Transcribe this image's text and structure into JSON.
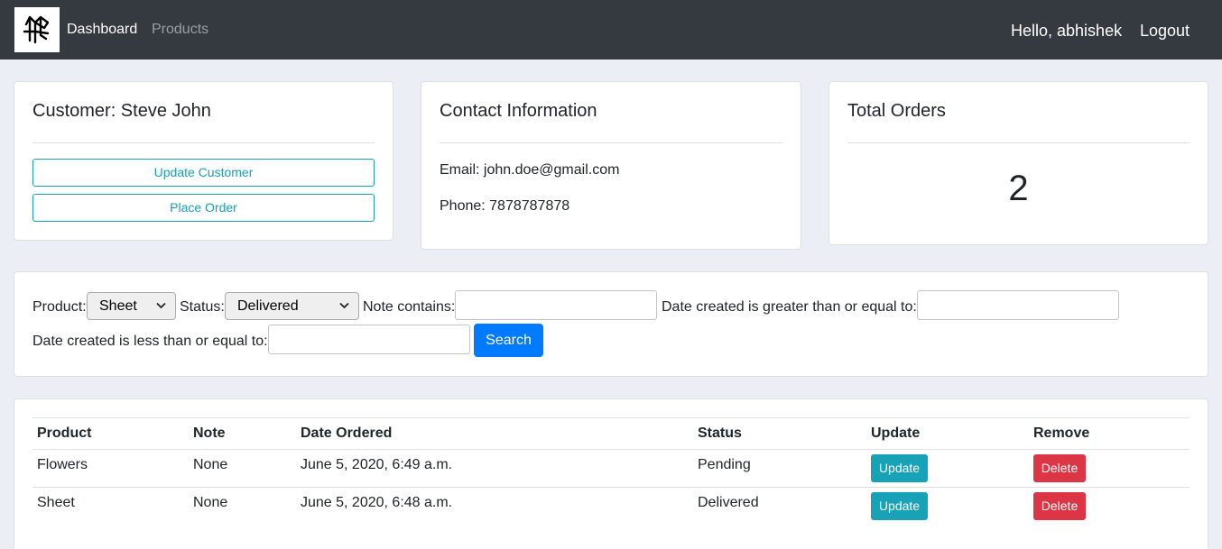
{
  "navbar": {
    "logo_name": "brand-logo",
    "links": [
      "Dashboard",
      "Products"
    ],
    "greeting": "Hello, abhishek",
    "logout": "Logout"
  },
  "customer_card": {
    "title": "Customer: Steve John",
    "update_button": "Update Customer",
    "place_order_button": "Place Order"
  },
  "contact_card": {
    "title": "Contact Information",
    "email": "Email: john.doe@gmail.com",
    "phone": "Phone: 7878787878"
  },
  "orders_card": {
    "title": "Total Orders",
    "value": "2"
  },
  "filter": {
    "product_label": "Product:",
    "product_value": "Sheet",
    "status_label": "Status:",
    "status_value": "Delivered",
    "note_label": "Note contains:",
    "note_value": "",
    "date_gte_label": "Date created is greater than or equal to:",
    "date_gte_value": "",
    "date_lte_label": "Date created is less than or equal to:",
    "date_lte_value": "",
    "search_button": "Search"
  },
  "orders_table": {
    "headers": [
      "Product",
      "Note",
      "Date Ordered",
      "Status",
      "Update",
      "Remove"
    ],
    "rows": [
      {
        "product": "Flowers",
        "note": "None",
        "date": "June 5, 2020, 6:49 a.m.",
        "status": "Pending",
        "update": "Update",
        "remove": "Delete"
      },
      {
        "product": "Sheet",
        "note": "None",
        "date": "June 5, 2020, 6:48 a.m.",
        "status": "Delivered",
        "update": "Update",
        "remove": "Delete"
      }
    ]
  },
  "colors": {
    "navbar": "#343a40",
    "background": "#ebeef4",
    "info": "#17a2b8",
    "primary": "#007bff",
    "danger": "#dc3545"
  }
}
